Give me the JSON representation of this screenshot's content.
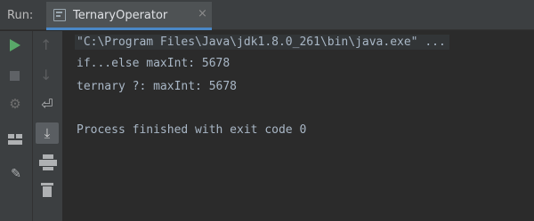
{
  "run_panel": {
    "label": "Run:",
    "tab": {
      "title": "TernaryOperator",
      "close": "×",
      "icon": "console-icon"
    }
  },
  "toolbar_left": [
    {
      "name": "rerun-icon",
      "glyph": "▶"
    },
    {
      "name": "stop-icon",
      "glyph": "■"
    },
    {
      "name": "rerun-debug-icon",
      "glyph": "⟳"
    },
    {
      "name": "restore-layout-icon",
      "glyph": "▦"
    },
    {
      "name": "pin-tab-icon",
      "glyph": "📌"
    }
  ],
  "toolbar_right": [
    {
      "name": "up-stack-icon",
      "glyph": "↑"
    },
    {
      "name": "down-stack-icon",
      "glyph": "↓"
    },
    {
      "name": "soft-wrap-icon",
      "glyph": "⤶"
    },
    {
      "name": "scroll-to-end-icon",
      "glyph": "⤓"
    },
    {
      "name": "print-icon",
      "glyph": "⎙"
    },
    {
      "name": "clear-all-icon",
      "glyph": "🗑"
    }
  ],
  "console": {
    "command": "\"C:\\Program Files\\Java\\jdk1.8.0_261\\bin\\java.exe\" ...",
    "output_line_1": "if...else maxInt: 5678",
    "output_line_2": "ternary ?: maxInt: 5678",
    "exit_message": "Process finished with exit code 0"
  },
  "colors": {
    "background": "#2b2b2b",
    "panel": "#3c3f41",
    "text": "#a9b7c6",
    "run_green": "#59a869",
    "tab_underline": "#4a88c7"
  }
}
